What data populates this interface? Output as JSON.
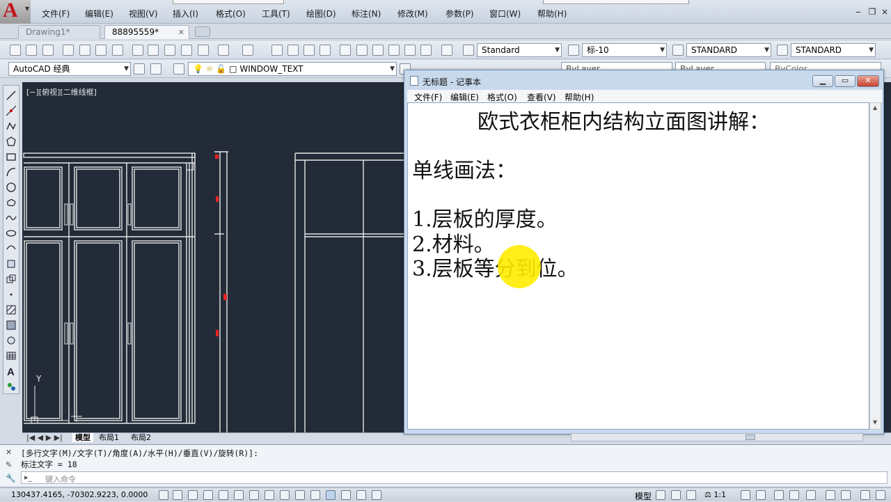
{
  "menubar": {
    "items": [
      "文件(F)",
      "编辑(E)",
      "视图(V)",
      "插入(I)",
      "格式(O)",
      "工具(T)",
      "绘图(D)",
      "标注(N)",
      "修改(M)",
      "参数(P)",
      "窗口(W)",
      "帮助(H)"
    ],
    "window_controls": [
      "‒",
      "❐",
      "×"
    ]
  },
  "tabs": [
    {
      "label": "Drawing1*"
    },
    {
      "label": "88895559*"
    }
  ],
  "toolbar": {
    "text_style": "Standard",
    "dim_style": "标-10",
    "table_style": "STANDARD",
    "multileader_style": "STANDARD",
    "workspace": "AutoCAD 经典",
    "layer": "WINDOW_TEXT",
    "bylayer_1": "ByLayer",
    "bylayer_2": "ByLayer",
    "bycolor": "ByColor"
  },
  "drawing": {
    "view_label": "[−][俯视][二维线框]",
    "y_axis_label": "Y"
  },
  "layout_tabs": [
    "模型",
    "布局1",
    "布局2"
  ],
  "command": {
    "history_1": "[多行文字(M)/文字(T)/角度(A)/水平(H)/垂直(V)/旋转(R)]:",
    "history_2": "标注文字 = 18",
    "input_placeholder": "键入命令"
  },
  "status": {
    "coordinates": "130437.4165, -70302.9223, 0.0000",
    "model_label": "模型",
    "scale": "1:1"
  },
  "notepad": {
    "title": "无标题 - 记事本",
    "menu": [
      "文件(F)",
      "编辑(E)",
      "格式(O)",
      "查看(V)",
      "帮助(H)"
    ],
    "lines": [
      "欧式衣柜柜内结构立面图讲解：",
      "单线画法：",
      "1.层板的厚度。",
      "2.材料。",
      "3.层板等分到位。"
    ]
  },
  "colors": {
    "drawing_bg": "#222b37",
    "highlight": "#ffec00",
    "logo_red": "#c0161b"
  }
}
